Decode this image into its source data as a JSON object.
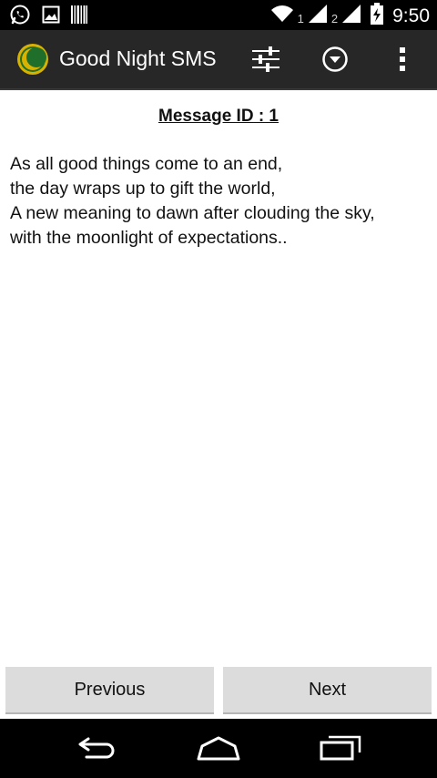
{
  "status_bar": {
    "sim1_label": "1",
    "sim2_label": "2",
    "time": "9:50",
    "icons": [
      "whatsapp-icon",
      "image-icon",
      "barcode-icon",
      "wifi-icon",
      "signal-icon",
      "battery-charging-icon"
    ]
  },
  "action_bar": {
    "title": "Good Night SMS",
    "icons": [
      "app-logo-moon-icon",
      "settings-sliders-icon",
      "dropdown-circle-icon",
      "overflow-menu-icon"
    ]
  },
  "message": {
    "id_label": "Message ID : 1",
    "lines": [
      "As all good things come to an end,",
      "the day wraps up to gift the world,",
      "A new meaning to dawn after clouding the sky,",
      "with the moonlight of expectations.."
    ]
  },
  "buttons": {
    "previous": "Previous",
    "next": "Next"
  },
  "system_nav": {
    "icons": [
      "back-icon",
      "home-icon",
      "recent-apps-icon"
    ]
  },
  "colors": {
    "action_bar_bg": "#272727",
    "button_bg": "#dcdcdc",
    "logo_gold": "#d9b200",
    "logo_green": "#1f6e2a"
  }
}
